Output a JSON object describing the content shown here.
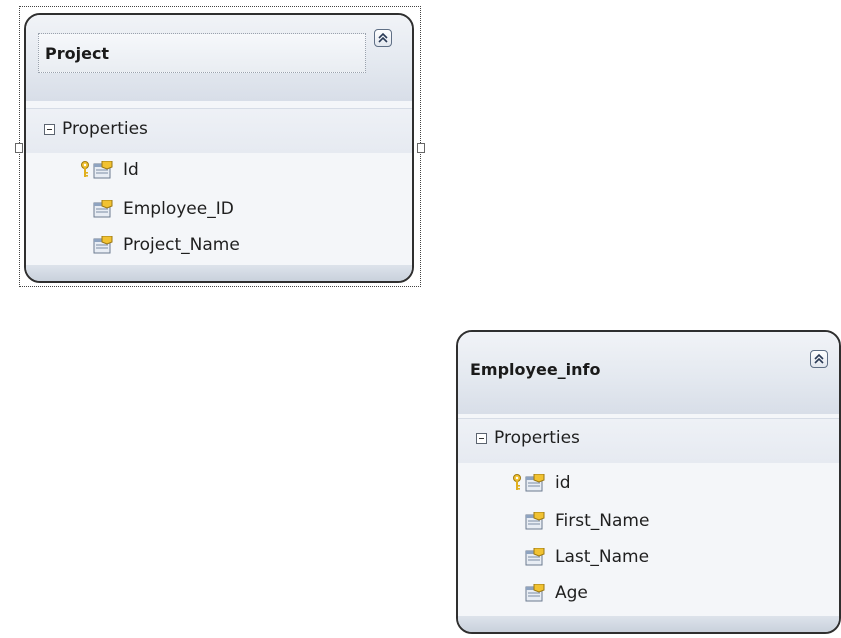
{
  "entities": [
    {
      "title": "Project",
      "section_label": "Properties",
      "properties": [
        {
          "name": "Id",
          "key": true
        },
        {
          "name": "Employee_ID",
          "key": false
        },
        {
          "name": "Project_Name",
          "key": false
        }
      ]
    },
    {
      "title": "Employee_info",
      "section_label": "Properties",
      "properties": [
        {
          "name": "id",
          "key": true
        },
        {
          "name": "First_Name",
          "key": false
        },
        {
          "name": "Last_Name",
          "key": false
        },
        {
          "name": "Age",
          "key": false
        }
      ]
    }
  ],
  "icons": {
    "collapse": "double-chevron-up-icon",
    "section_toggle": "minus-box-icon",
    "primary_key": "key-icon",
    "property": "property-icon"
  }
}
